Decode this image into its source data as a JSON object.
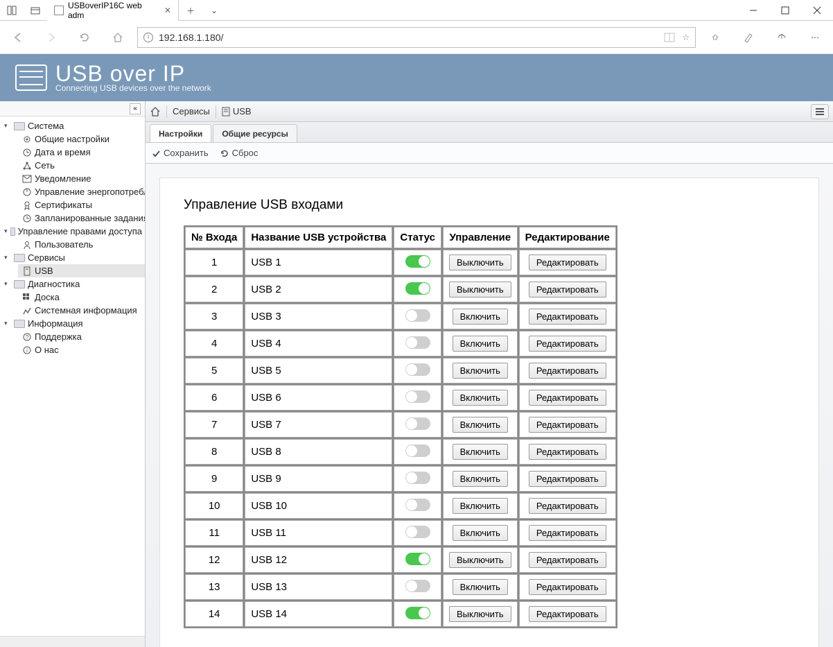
{
  "browser": {
    "tab_title": "USBoverIP16C web adm",
    "url": "192.168.1.180/"
  },
  "banner": {
    "title": "USB over IP",
    "subtitle": "Connecting USB devices over the network"
  },
  "sidebar": {
    "groups": [
      {
        "label": "Система",
        "items": [
          {
            "label": "Общие настройки"
          },
          {
            "label": "Дата и время"
          },
          {
            "label": "Сеть"
          },
          {
            "label": "Уведомление"
          },
          {
            "label": "Управление энергопотреблени"
          },
          {
            "label": "Сертификаты"
          },
          {
            "label": "Запланированные задания"
          }
        ]
      },
      {
        "label": "Управление правами доступа",
        "items": [
          {
            "label": "Пользователь"
          }
        ]
      },
      {
        "label": "Сервисы",
        "items": [
          {
            "label": "USB",
            "selected": true
          }
        ]
      },
      {
        "label": "Диагностика",
        "items": [
          {
            "label": "Доска"
          },
          {
            "label": "Системная информация"
          }
        ]
      },
      {
        "label": "Информация",
        "items": [
          {
            "label": "Поддержка"
          },
          {
            "label": "О нас"
          }
        ]
      }
    ]
  },
  "breadcrumb": {
    "level1": "Сервисы",
    "level2": "USB"
  },
  "page_tabs": {
    "active": "Настройки",
    "other": "Общие ресурсы"
  },
  "toolbar": {
    "save": "Сохранить",
    "reset": "Сброс"
  },
  "card": {
    "heading": "Управление USB входами",
    "columns": {
      "input_no": "№ Входа",
      "device_name": "Название USB устройства",
      "status": "Статус",
      "control": "Управление",
      "edit": "Редактирование"
    },
    "labels": {
      "turn_off": "Выключить",
      "turn_on": "Включить",
      "edit": "Редактировать"
    },
    "rows": [
      {
        "no": 1,
        "name": "USB 1",
        "on": true
      },
      {
        "no": 2,
        "name": "USB 2",
        "on": true
      },
      {
        "no": 3,
        "name": "USB 3",
        "on": false
      },
      {
        "no": 4,
        "name": "USB 4",
        "on": false
      },
      {
        "no": 5,
        "name": "USB 5",
        "on": false
      },
      {
        "no": 6,
        "name": "USB 6",
        "on": false
      },
      {
        "no": 7,
        "name": "USB 7",
        "on": false
      },
      {
        "no": 8,
        "name": "USB 8",
        "on": false
      },
      {
        "no": 9,
        "name": "USB 9",
        "on": false
      },
      {
        "no": 10,
        "name": "USB 10",
        "on": false
      },
      {
        "no": 11,
        "name": "USB 11",
        "on": false
      },
      {
        "no": 12,
        "name": "USB 12",
        "on": true
      },
      {
        "no": 13,
        "name": "USB 13",
        "on": false
      },
      {
        "no": 14,
        "name": "USB 14",
        "on": true
      }
    ]
  }
}
